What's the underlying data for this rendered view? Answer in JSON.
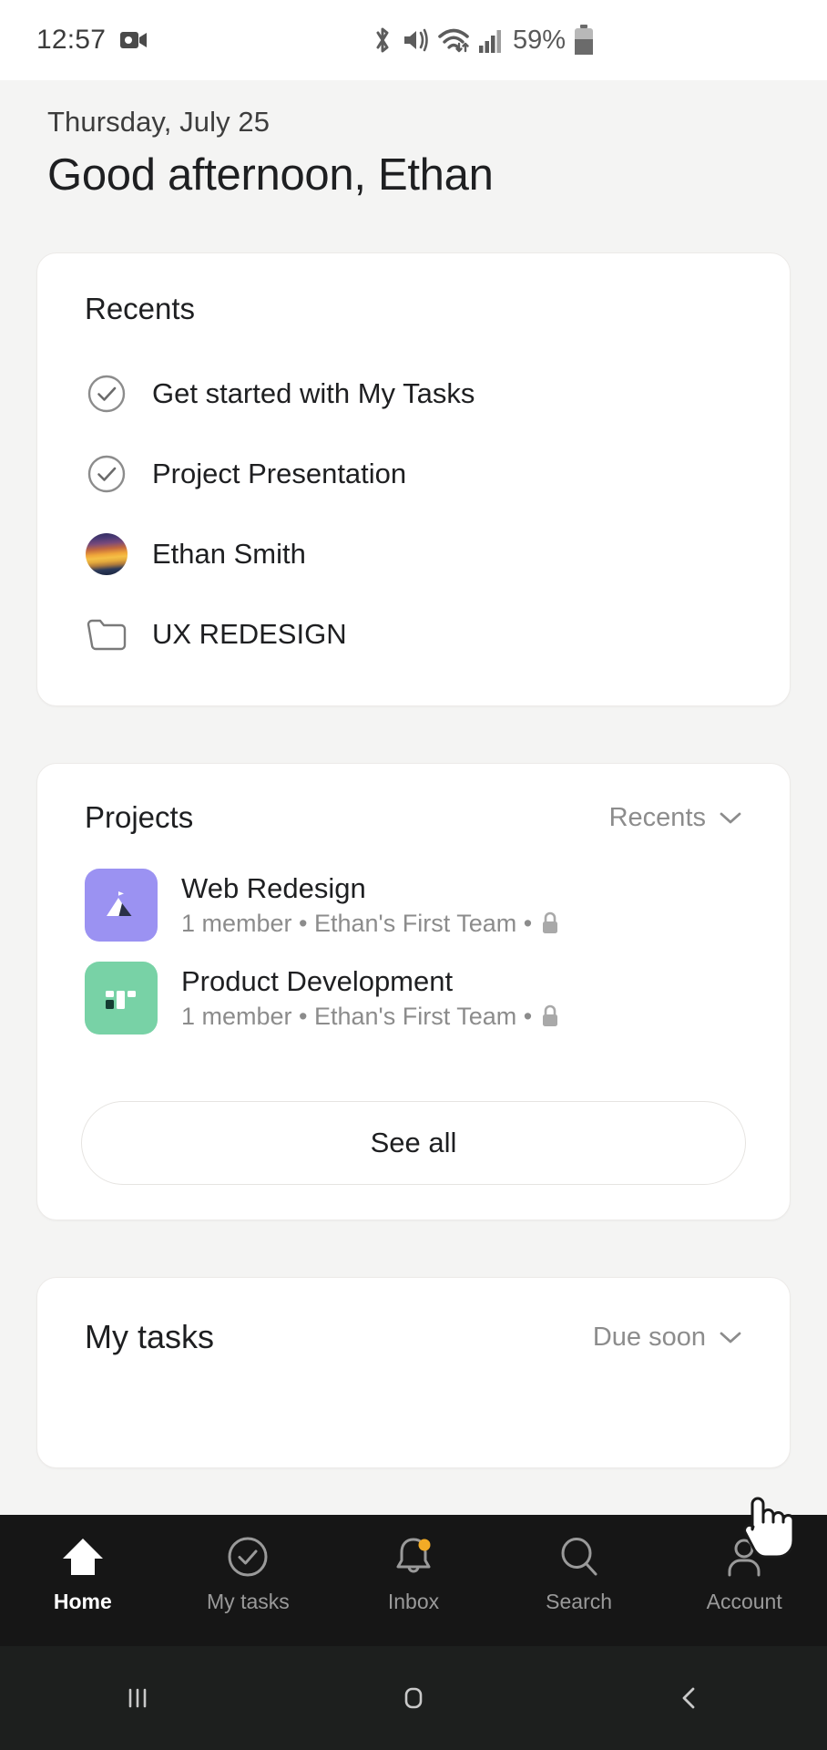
{
  "status_bar": {
    "time": "12:57",
    "battery_percent": "59%",
    "icons": [
      "camera-recording-icon",
      "bluetooth-icon",
      "mute-vibrate-icon",
      "wifi-icon",
      "cellular-signal-icon",
      "battery-icon"
    ]
  },
  "greeting": {
    "date": "Thursday, July 25",
    "title": "Good afternoon, Ethan"
  },
  "recents": {
    "title": "Recents",
    "items": [
      {
        "label": "Get started with My Tasks",
        "icon": "check-circle-icon"
      },
      {
        "label": "Project Presentation",
        "icon": "check-circle-icon"
      },
      {
        "label": "Ethan Smith",
        "icon": "avatar-photo"
      },
      {
        "label": "UX REDESIGN",
        "icon": "folder-icon"
      }
    ]
  },
  "projects": {
    "title": "Projects",
    "sort_label": "Recents",
    "sort_icon": "chevron-down-icon",
    "see_all_label": "See all",
    "items": [
      {
        "name": "Web Redesign",
        "members": "1 member",
        "separator": " • ",
        "team": "Ethan's First Team",
        "meta": "1 member • Ethan's First Team • ",
        "privacy_icon": "lock-icon",
        "color": "#9b92f2",
        "thumb_icon": "mountain-icon"
      },
      {
        "name": "Product Development",
        "members": "1 member",
        "separator": " • ",
        "team": "Ethan's First Team",
        "meta": "1 member • Ethan's First Team • ",
        "privacy_icon": "lock-icon",
        "color": "#78d2a6",
        "thumb_icon": "board-icon"
      }
    ]
  },
  "my_tasks": {
    "title": "My tasks",
    "sort_label": "Due soon",
    "sort_icon": "chevron-down-icon"
  },
  "bottom_nav": {
    "items": [
      {
        "label": "Home",
        "icon": "home-icon",
        "active": true,
        "badge": false
      },
      {
        "label": "My tasks",
        "icon": "check-circle-icon",
        "active": false,
        "badge": false
      },
      {
        "label": "Inbox",
        "icon": "bell-icon",
        "active": false,
        "badge": true
      },
      {
        "label": "Search",
        "icon": "search-icon",
        "active": false,
        "badge": false
      },
      {
        "label": "Account",
        "icon": "person-icon",
        "active": false,
        "badge": false
      }
    ],
    "badge_color": "#f2ab26"
  },
  "system_nav": {
    "recents_label": "recent-apps-button",
    "home_label": "home-button",
    "back_label": "back-button"
  },
  "colors": {
    "page_background": "#f4f4f3",
    "card_background": "#ffffff",
    "text_primary": "#1e1f21",
    "text_secondary": "#8c8c8c",
    "nav_background": "#161616",
    "accent_badge": "#f2ab26"
  }
}
